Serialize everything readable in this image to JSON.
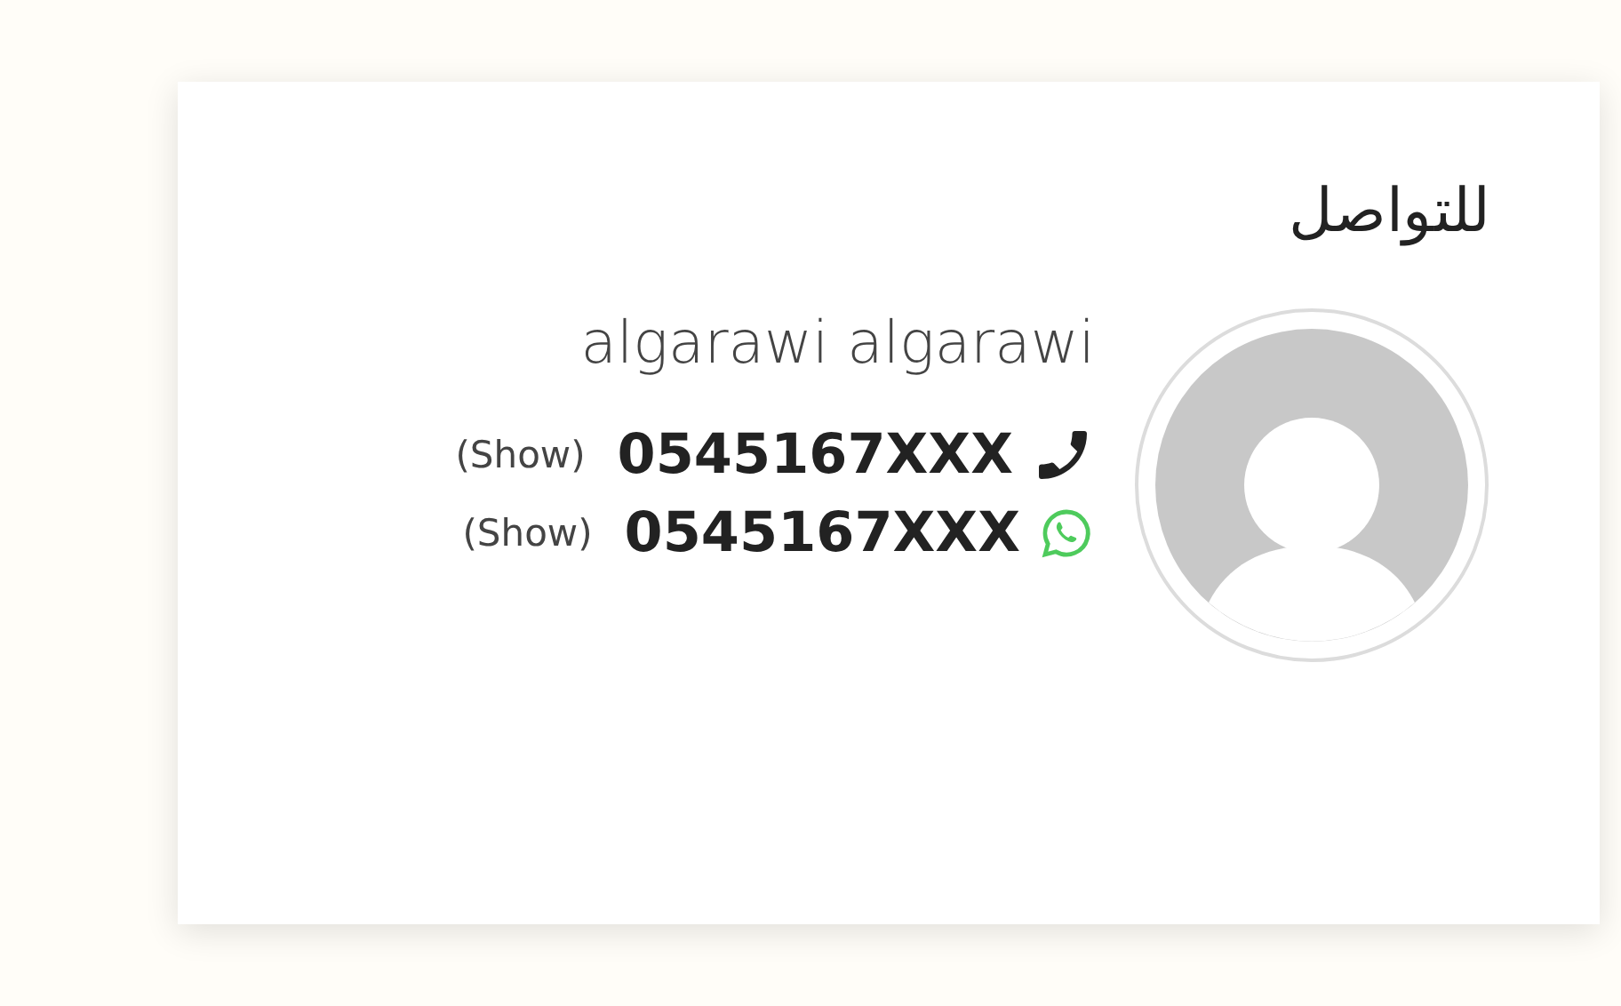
{
  "card": {
    "title": "للتواصل",
    "avatar": {
      "kind": "avatar"
    },
    "name": "algarawi algarawi",
    "phones": [
      {
        "kind": "phone",
        "number": "0545167XXX",
        "action": "(Show)"
      },
      {
        "kind": "whatsapp",
        "number": "0545167XXX",
        "action": "(Show)"
      }
    ]
  }
}
